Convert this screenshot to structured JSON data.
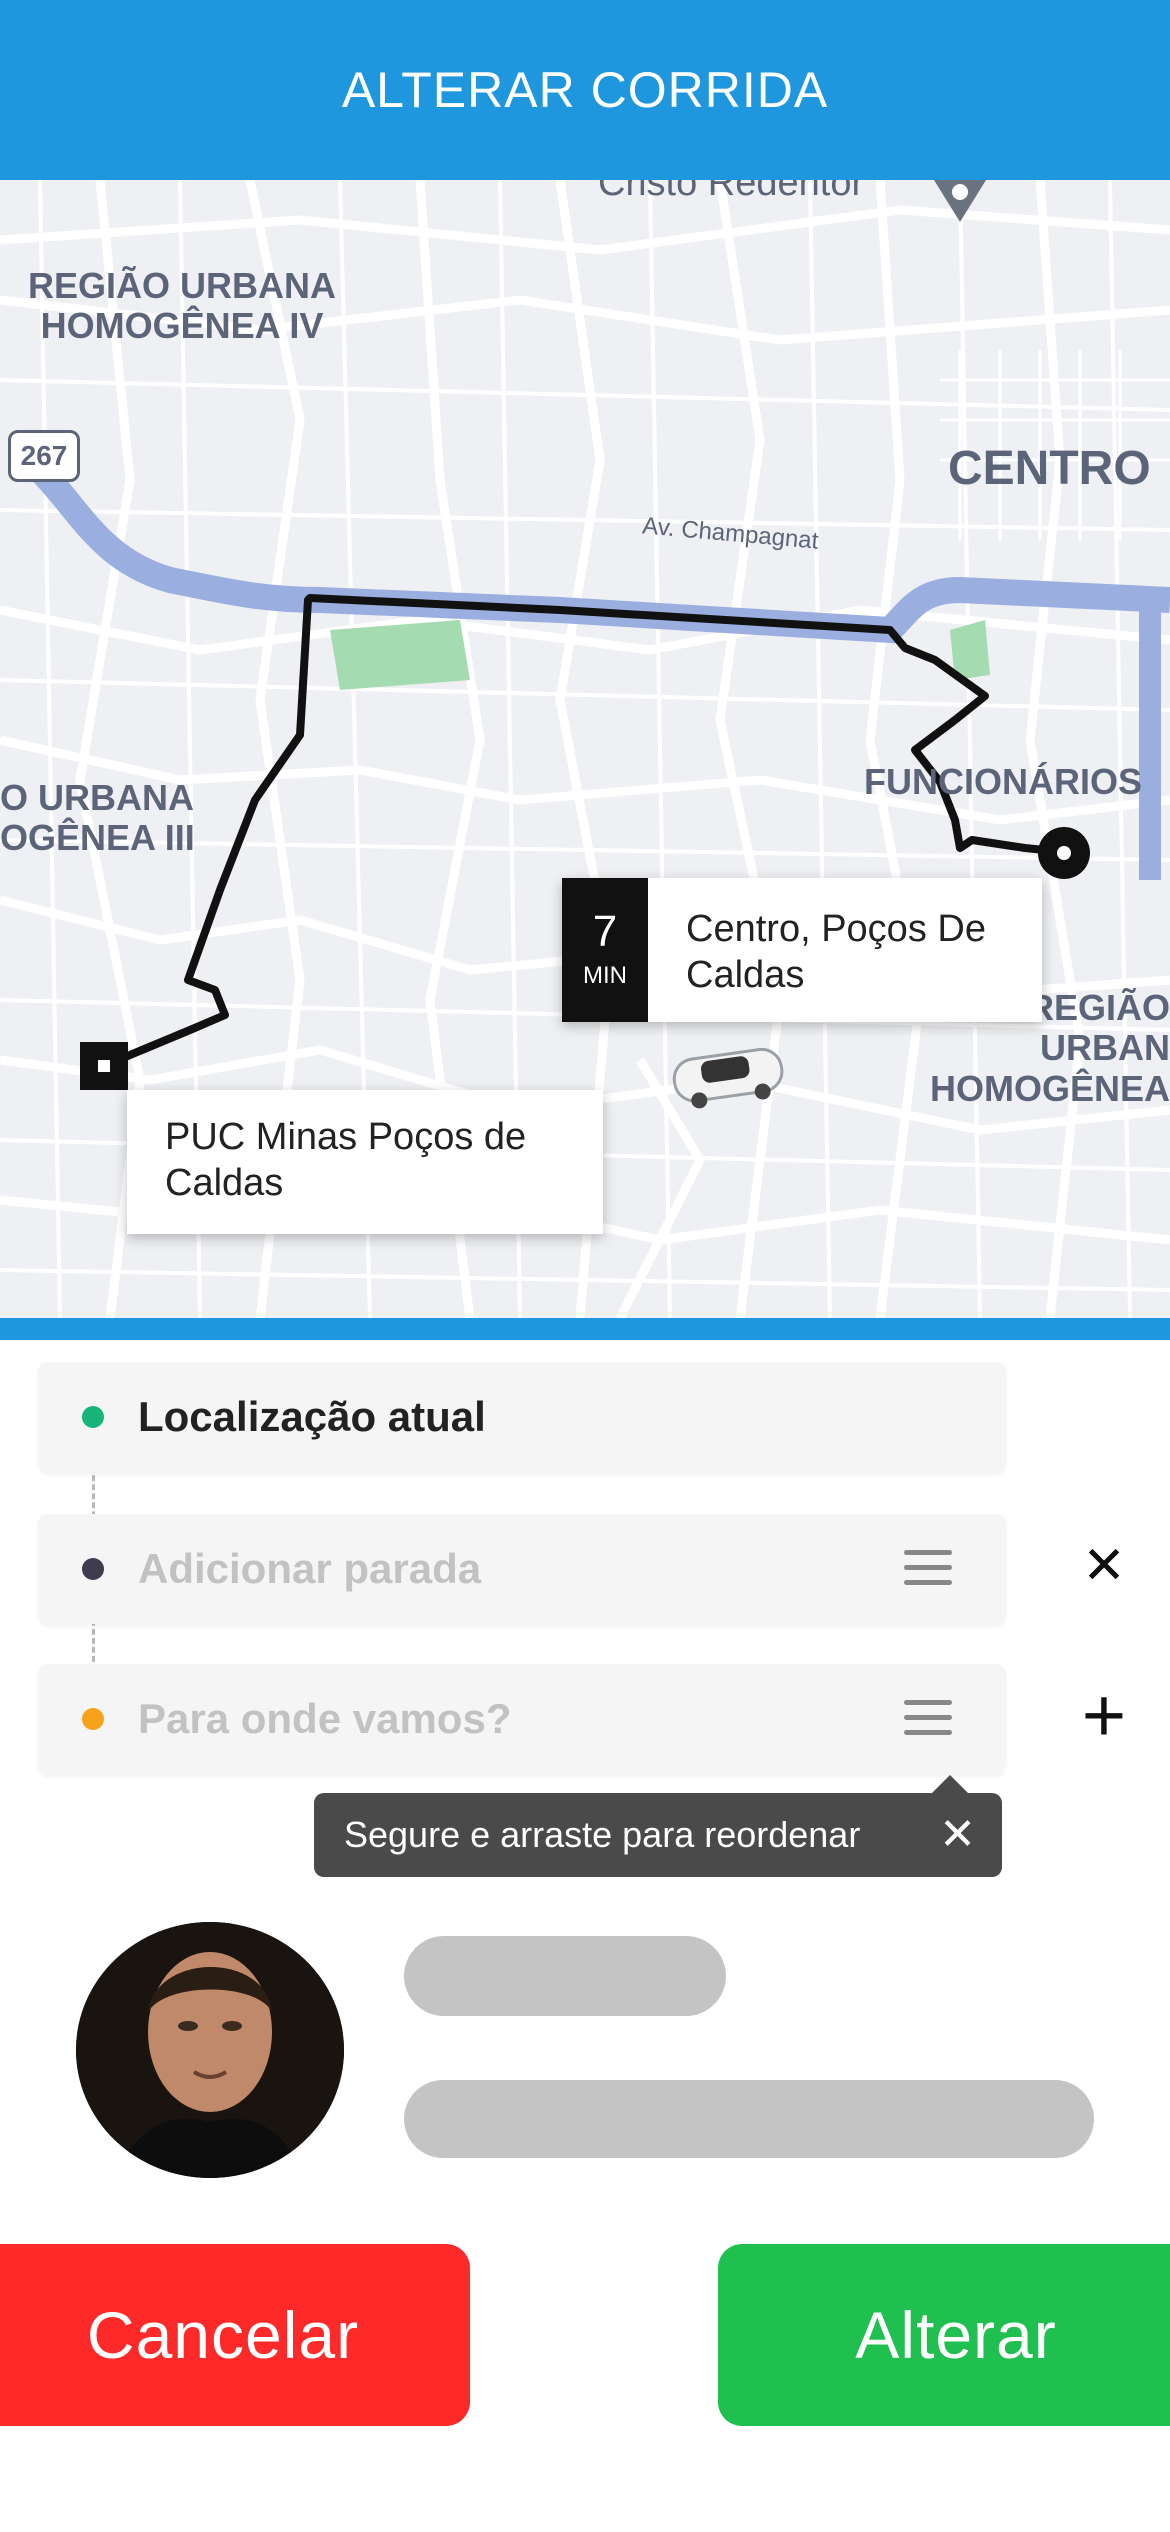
{
  "header": {
    "title": "ALTERAR CORRIDA"
  },
  "map": {
    "labels": {
      "cristo": "Cristo Redentor",
      "regiao_iv": "REGIÃO URBANA\nHOMOGÊNEA IV",
      "centro": "CENTRO",
      "regiao_iii": "O URBANA\nOGÊNEA III",
      "funcionarios": "FUNCIONÁRIOS",
      "regiao_right": "REGIÃO URBAN\nHOMOGÊNEA",
      "street": "Av. Champagnat",
      "highway": "267"
    },
    "destination_card": {
      "eta_value": "7",
      "eta_unit": "MIN",
      "place": "Centro, Poços De Caldas"
    },
    "origin_card": {
      "place": "PUC Minas Poços de Caldas"
    }
  },
  "stops": {
    "current": {
      "label": "Localização atual",
      "dot_color": "#19b47a"
    },
    "add_stop": {
      "placeholder": "Adicionar parada",
      "dot_color": "#3d3d4f"
    },
    "destination": {
      "placeholder": "Para onde vamos?",
      "dot_color": "#f7a21b"
    }
  },
  "tooltip": {
    "text": "Segure e arraste para reordenar",
    "close_symbol": "✕"
  },
  "side_icons": {
    "remove": "✕",
    "add": "+"
  },
  "buttons": {
    "cancel": "Cancelar",
    "confirm": "Alterar"
  },
  "colors": {
    "header": "#1e97de",
    "cancel": "#fe2a2a",
    "confirm": "#1fc04f",
    "route": "#111111",
    "river": "#9aaee0"
  }
}
